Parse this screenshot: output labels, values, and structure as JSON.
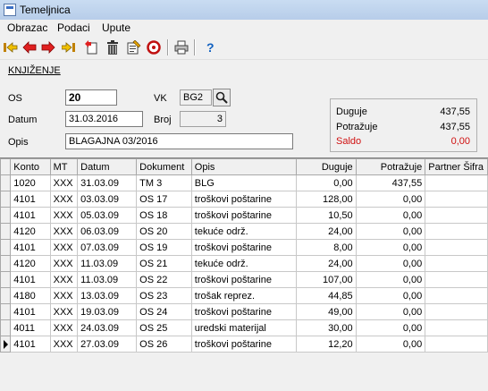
{
  "window": {
    "title": "Temeljnica"
  },
  "menu": [
    "Obrazac",
    "Podaci",
    "Upute"
  ],
  "toolbar": {
    "icons": [
      "first-icon",
      "prev-icon",
      "next-icon",
      "last-icon",
      "add-icon",
      "delete-icon",
      "edit-icon",
      "refresh-icon",
      "print-icon",
      "help-icon"
    ]
  },
  "section_label": "KNJIŽENJE",
  "form": {
    "os_label": "OS",
    "os_value": "20",
    "vk_label": "VK",
    "vk_value": "BG2",
    "datum_label": "Datum",
    "datum_value": "31.03.2016",
    "broj_label": "Broj",
    "broj_value": "3",
    "opis_label": "Opis",
    "opis_value": "BLAGAJNA 03/2016"
  },
  "saldo": {
    "duguje_label": "Duguje",
    "duguje_value": "437,55",
    "potrazuje_label": "Potražuje",
    "potrazuje_value": "437,55",
    "saldo_label": "Saldo",
    "saldo_value": "0,00",
    "saldo_color": "#d01010"
  },
  "table": {
    "columns": [
      "Konto",
      "MT",
      "Datum",
      "Dokument",
      "Opis",
      "Duguje",
      "Potražuje",
      "Partner Šifra"
    ],
    "rows": [
      [
        "1020",
        "XXX",
        "31.03.09",
        "TM 3",
        "BLG",
        "0,00",
        "437,55",
        ""
      ],
      [
        "4101",
        "XXX",
        "03.03.09",
        "OS 17",
        "troškovi poštarine",
        "128,00",
        "0,00",
        ""
      ],
      [
        "4101",
        "XXX",
        "05.03.09",
        "OS 18",
        "troškovi poštarine",
        "10,50",
        "0,00",
        ""
      ],
      [
        "4120",
        "XXX",
        "06.03.09",
        "OS 20",
        "tekuće održ.",
        "24,00",
        "0,00",
        ""
      ],
      [
        "4101",
        "XXX",
        "07.03.09",
        "OS 19",
        "troškovi poštarine",
        "8,00",
        "0,00",
        ""
      ],
      [
        "4120",
        "XXX",
        "11.03.09",
        "OS 21",
        "tekuće održ.",
        "24,00",
        "0,00",
        ""
      ],
      [
        "4101",
        "XXX",
        "11.03.09",
        "OS 22",
        "troškovi poštarine",
        "107,00",
        "0,00",
        ""
      ],
      [
        "4180",
        "XXX",
        "13.03.09",
        "OS 23",
        "trošak reprez.",
        "44,85",
        "0,00",
        ""
      ],
      [
        "4101",
        "XXX",
        "19.03.09",
        "OS 24",
        "troškovi poštarine",
        "49,00",
        "0,00",
        ""
      ],
      [
        "4011",
        "XXX",
        "24.03.09",
        "OS 25",
        "uredski materijal",
        "30,00",
        "0,00",
        ""
      ],
      [
        "4101",
        "XXX",
        "27.03.09",
        "OS 26",
        "troškovi poštarine",
        "12,20",
        "0,00",
        ""
      ]
    ],
    "current_row": 10
  }
}
